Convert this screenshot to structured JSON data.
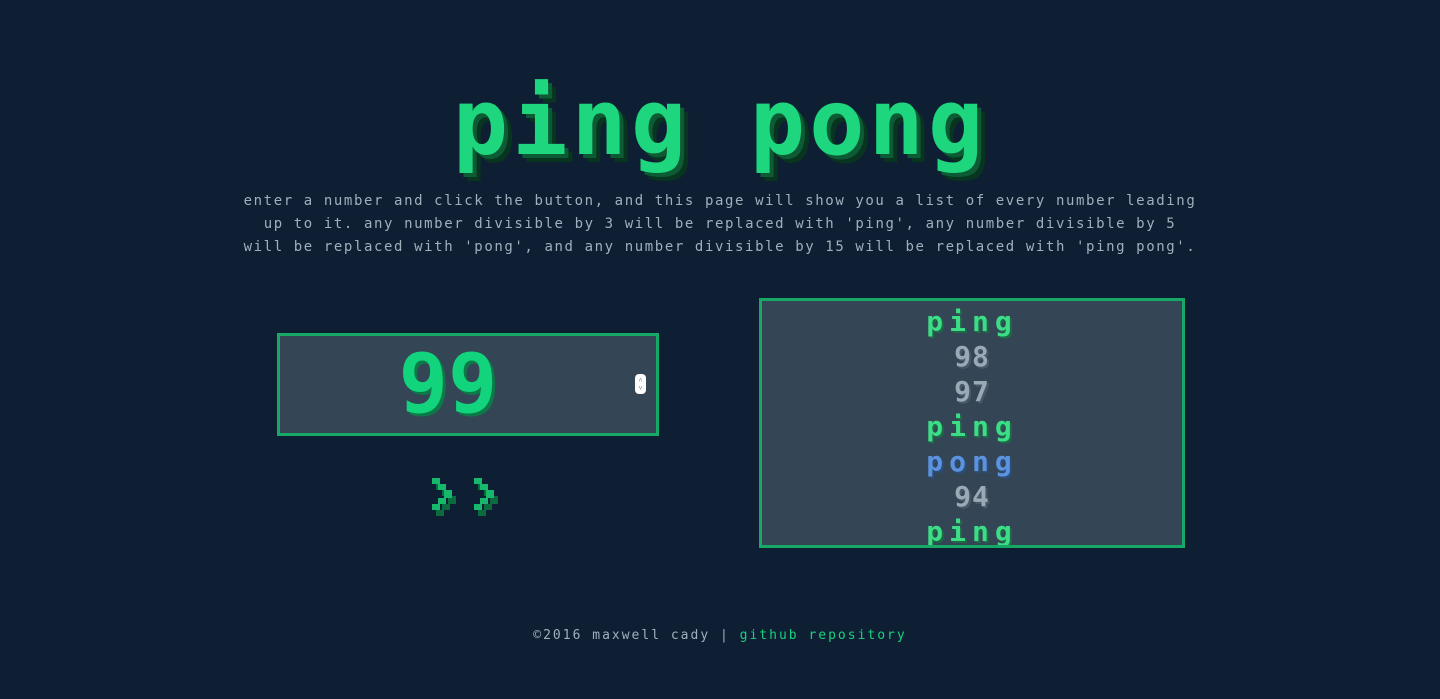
{
  "app": {
    "title": "ping pong"
  },
  "description": "enter a number and click the button, and this page will show you a list of every number leading up to it. any number divisible by 3 will be replaced with 'ping', any number divisible by 5 will be replaced with 'pong', and any number divisible by 15 will be replaced with 'ping pong'.",
  "number_input": {
    "value": "99",
    "spinner_up": "˄",
    "spinner_down": "˅"
  },
  "submit_button": {
    "icon": "double-chevron-right-icon"
  },
  "results": [
    {
      "text": "ping",
      "kind": "ping"
    },
    {
      "text": "98",
      "kind": "num"
    },
    {
      "text": "97",
      "kind": "num"
    },
    {
      "text": "ping",
      "kind": "ping"
    },
    {
      "text": "pong",
      "kind": "pong"
    },
    {
      "text": "94",
      "kind": "num"
    },
    {
      "text": "ping",
      "kind": "ping"
    }
  ],
  "footer": {
    "copyright": "©2016 maxwell cady",
    "separator": " | ",
    "link_label": "github repository"
  },
  "colors": {
    "background": "#0e1f33",
    "accent_green": "#1ed67e",
    "panel": "#344656",
    "border": "#16a865",
    "pong_blue": "#5b93e0"
  }
}
